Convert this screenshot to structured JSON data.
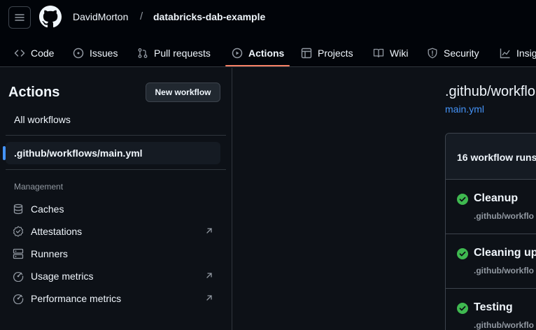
{
  "header": {
    "owner": "DavidMorton",
    "separator": "/",
    "repo": "databricks-dab-example"
  },
  "tabs": [
    {
      "label": "Code",
      "icon": "code-icon"
    },
    {
      "label": "Issues",
      "icon": "issue-icon"
    },
    {
      "label": "Pull requests",
      "icon": "pull-request-icon"
    },
    {
      "label": "Actions",
      "icon": "play-icon",
      "active": true
    },
    {
      "label": "Projects",
      "icon": "table-icon"
    },
    {
      "label": "Wiki",
      "icon": "book-icon"
    },
    {
      "label": "Security",
      "icon": "shield-icon"
    },
    {
      "label": "Insig",
      "icon": "graph-icon"
    }
  ],
  "sidebar": {
    "title": "Actions",
    "new_workflow": "New workflow",
    "all_workflows": "All workflows",
    "active_workflow": ".github/workflows/main.yml",
    "management_heading": "Management",
    "management_items": [
      {
        "label": "Caches",
        "icon": "database-icon",
        "external": false
      },
      {
        "label": "Attestations",
        "icon": "verified-icon",
        "external": true
      },
      {
        "label": "Runners",
        "icon": "server-icon",
        "external": false
      },
      {
        "label": "Usage metrics",
        "icon": "meter-icon",
        "external": true
      },
      {
        "label": "Performance metrics",
        "icon": "meter-icon",
        "external": true
      }
    ]
  },
  "main": {
    "title": ".github/workflo",
    "file_link": "main.yml",
    "runs_count": "16 workflow runs",
    "runs": [
      {
        "name": "Cleanup",
        "sub": ".github/workflo",
        "status": "success"
      },
      {
        "name": "Cleaning up",
        "sub": ".github/workflo",
        "status": "success"
      },
      {
        "name": "Testing",
        "sub": ".github/workflo",
        "status": "success"
      }
    ]
  },
  "colors": {
    "accent": "#f78166",
    "link": "#4493f8",
    "success": "#3fb950",
    "background": "#0d1117"
  }
}
